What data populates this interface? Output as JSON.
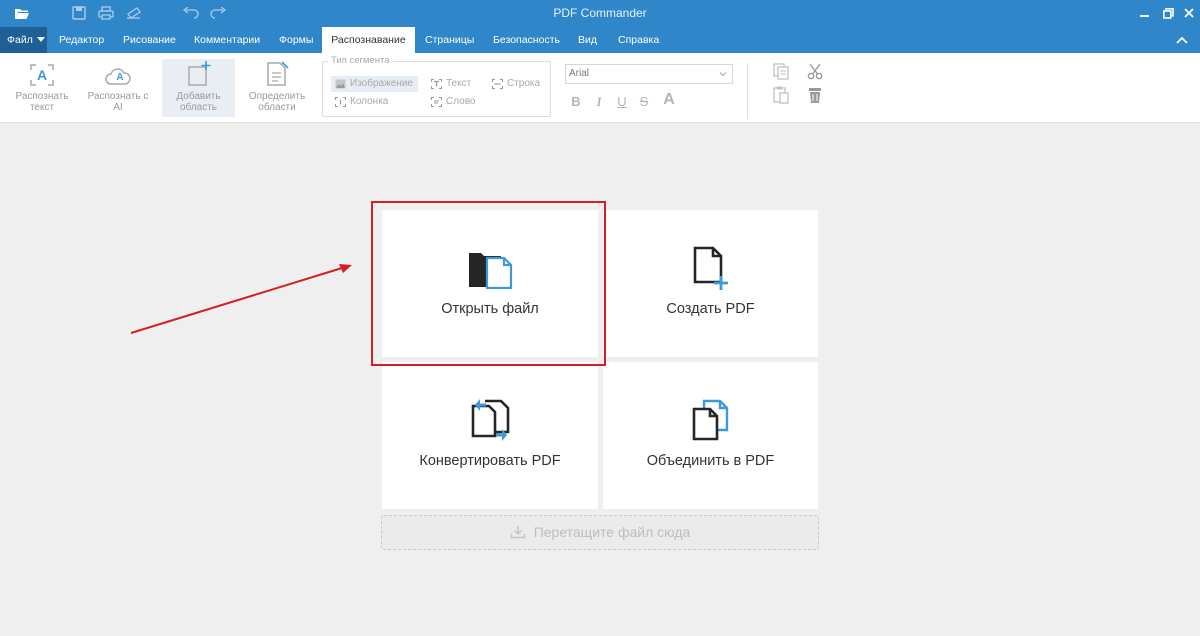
{
  "app": {
    "title": "PDF Commander"
  },
  "titlebar_icons": [
    "folder-open-icon",
    "save-icon",
    "print-icon",
    "send-icon",
    "undo-icon",
    "redo-icon"
  ],
  "window_controls": [
    "minimize-icon",
    "restore-icon",
    "close-icon"
  ],
  "menu": {
    "file_label": "Файл",
    "tabs": [
      {
        "label": "Редактор"
      },
      {
        "label": "Рисование"
      },
      {
        "label": "Комментарии"
      },
      {
        "label": "Формы"
      },
      {
        "label": "Распознавание",
        "active": true
      },
      {
        "label": "Страницы"
      },
      {
        "label": "Безопасность"
      },
      {
        "label": "Вид"
      },
      {
        "label": "Справка"
      }
    ]
  },
  "ribbon": {
    "buttons": [
      {
        "label": "Распознать текст",
        "icon": "recognize-text-icon"
      },
      {
        "label": "Распознать с AI",
        "icon": "recognize-ai-icon"
      },
      {
        "label": "Добавить область",
        "icon": "add-area-icon",
        "active": true
      },
      {
        "label": "Определить области",
        "icon": "detect-areas-icon"
      }
    ],
    "segment_group": {
      "title": "Тип сегмента",
      "options": [
        {
          "label": "Изображение",
          "icon": "image-icon",
          "selected": true
        },
        {
          "label": "Текст",
          "icon": "text-frame-icon"
        },
        {
          "label": "Строка",
          "icon": "line-icon"
        },
        {
          "label": "Колонка",
          "icon": "column-icon"
        },
        {
          "label": "Слово",
          "icon": "word-icon"
        }
      ]
    },
    "font": {
      "value": "Arial"
    },
    "format_buttons": [
      "B",
      "I",
      "U",
      "S",
      "A"
    ],
    "edit_icons": [
      "copy-icon",
      "cut-icon",
      "paste-icon",
      "delete-icon"
    ]
  },
  "start": {
    "tiles": [
      {
        "label": "Открыть файл",
        "icon": "open-file-icon"
      },
      {
        "label": "Создать PDF",
        "icon": "create-pdf-icon"
      },
      {
        "label": "Конвертировать PDF",
        "icon": "convert-pdf-icon"
      },
      {
        "label": "Объединить в PDF",
        "icon": "merge-pdf-icon"
      }
    ],
    "dropzone_label": "Перетащите файл сюда"
  },
  "colors": {
    "titlebar": "#2f86c9",
    "file_menu": "#1d5f96",
    "accent_blue": "#3d9ad9",
    "highlight_red": "#d31f26",
    "background": "#efefef"
  }
}
